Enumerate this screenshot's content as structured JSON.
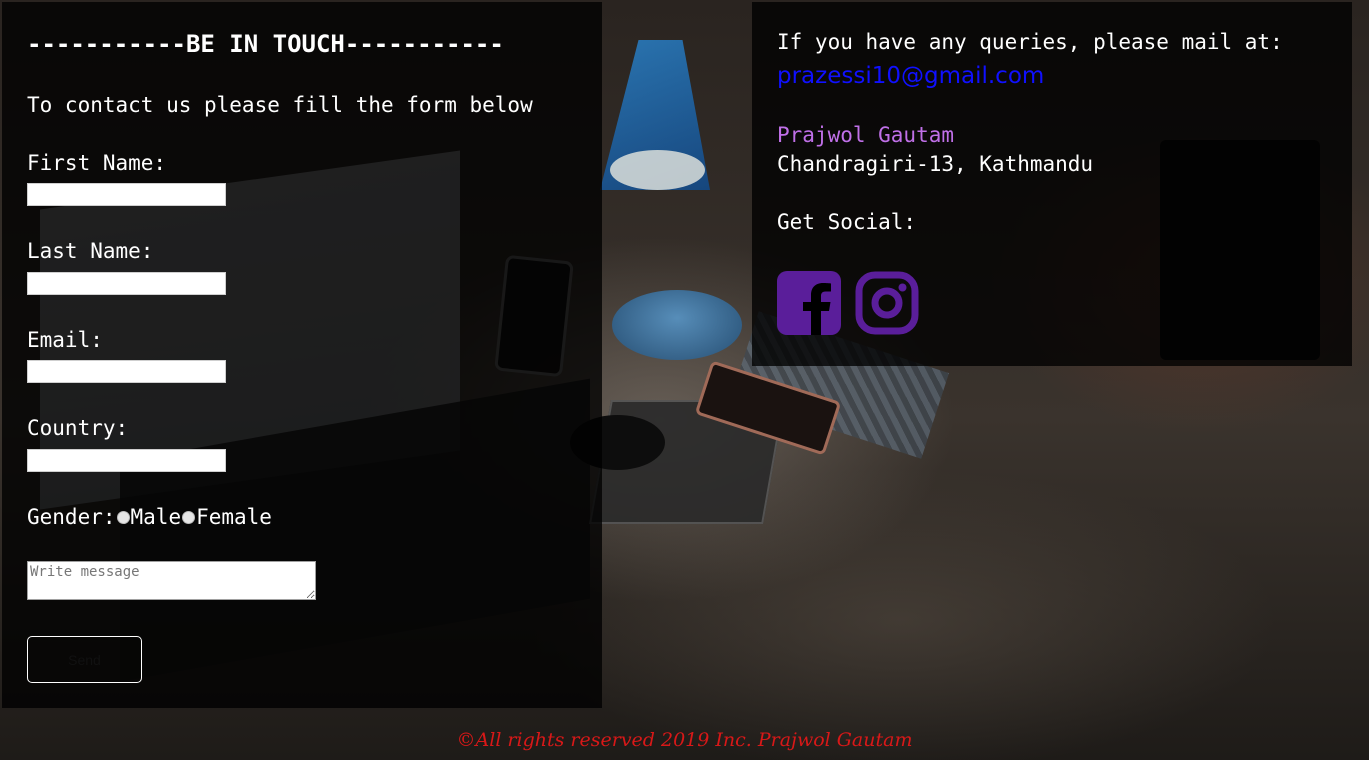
{
  "form": {
    "heading": "-----------BE IN TOUCH-----------",
    "intro": "To contact us please fill the form below",
    "first_name_label": "First Name:",
    "last_name_label": "Last Name:",
    "email_label": "Email:",
    "country_label": "Country:",
    "gender_label": "Gender:",
    "gender_options": [
      "Male",
      "Female"
    ],
    "message_placeholder": "Write message",
    "send_label": "Send"
  },
  "contact": {
    "query_text": "If you have any queries, please mail at:",
    "email": "prazessi10@gmail.com",
    "name": "Prajwol Gautam",
    "address": "Chandragiri-13, Kathmandu",
    "social_label": "Get Social:",
    "social_icons": [
      "facebook-icon",
      "instagram-icon"
    ],
    "name_color": "#c070e8",
    "email_color": "#1010ff",
    "social_color": "#5a1e9a"
  },
  "footer": {
    "text": "©All rights reserved 2019 Inc. Prajwol Gautam",
    "color": "#d81818"
  }
}
